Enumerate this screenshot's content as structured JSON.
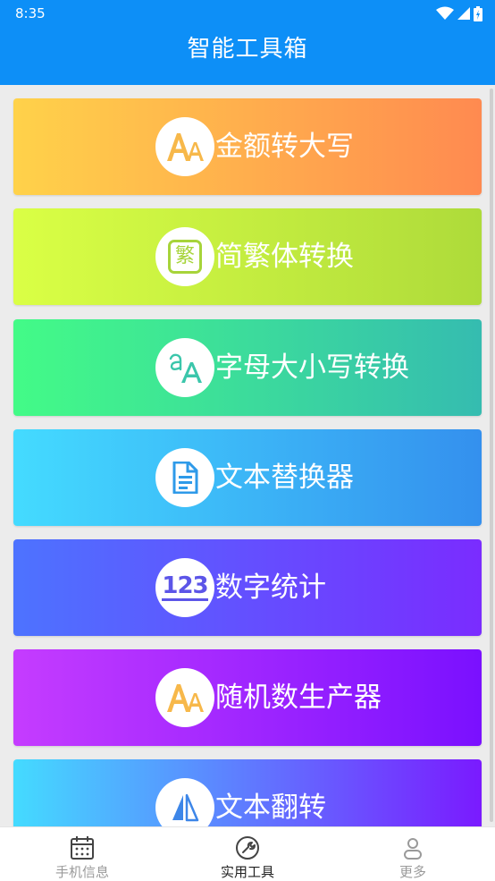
{
  "status_bar": {
    "time": "8:35",
    "icons": [
      "wifi-icon",
      "signal-icon",
      "battery-icon"
    ]
  },
  "header": {
    "title": "智能工具箱",
    "background": "#0d8ff7"
  },
  "tools": [
    {
      "label": "金额转大写",
      "icon": "font-aa-icon"
    },
    {
      "label": "简繁体转换",
      "icon": "traditional-char-icon",
      "badge": "繁"
    },
    {
      "label": "字母大小写转换",
      "icon": "letter-case-icon"
    },
    {
      "label": "文本替换器",
      "icon": "document-icon"
    },
    {
      "label": "数字统计",
      "icon": "number-123-icon",
      "badge": "123"
    },
    {
      "label": "随机数生产器",
      "icon": "font-aa-icon"
    },
    {
      "label": "文本翻转",
      "icon": "flip-icon"
    }
  ],
  "bottom_nav": {
    "items": [
      {
        "label": "手机信息",
        "icon": "calendar-icon",
        "active": false
      },
      {
        "label": "实用工具",
        "icon": "wrench-icon",
        "active": true
      },
      {
        "label": "更多",
        "icon": "user-icon",
        "active": false
      }
    ],
    "active_color": "#222222",
    "inactive_color": "#9a9a9a"
  }
}
